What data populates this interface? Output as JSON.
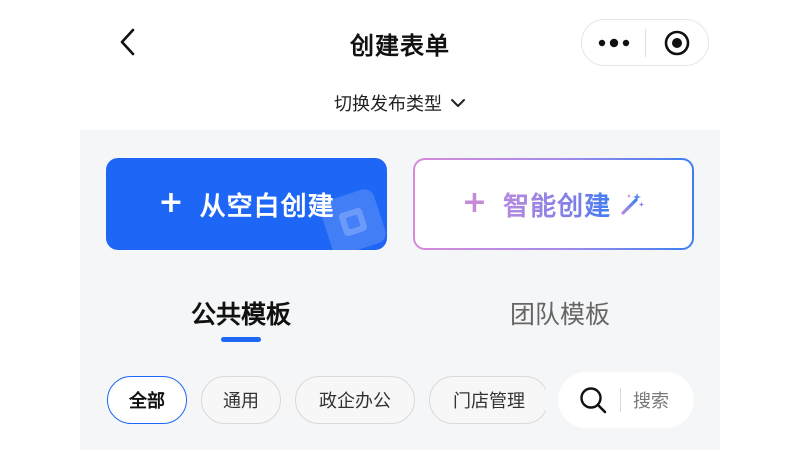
{
  "navbar": {
    "title": "创建表单",
    "back_icon": "chevron-left-icon",
    "more_icon": "more-dots-icon",
    "close_icon": "record-target-icon"
  },
  "publish_type": {
    "label": "切换发布类型",
    "icon": "chevron-down-icon"
  },
  "create_buttons": {
    "blank": {
      "plus": "+",
      "label": "从空白创建",
      "color": "#1e66f5"
    },
    "smart": {
      "plus": "+",
      "label": "智能创建",
      "icon": "magic-wand-icon"
    }
  },
  "tabs": [
    {
      "label": "公共模板",
      "active": true
    },
    {
      "label": "团队模板",
      "active": false
    }
  ],
  "categories": [
    {
      "label": "全部",
      "selected": true
    },
    {
      "label": "通用",
      "selected": false
    },
    {
      "label": "政企办公",
      "selected": false
    },
    {
      "label": "门店管理",
      "selected": false
    }
  ],
  "search": {
    "placeholder": "搜索",
    "icon": "search-icon"
  },
  "colors": {
    "accent": "#1e66f5",
    "panel_bg": "#f5f6f8"
  }
}
